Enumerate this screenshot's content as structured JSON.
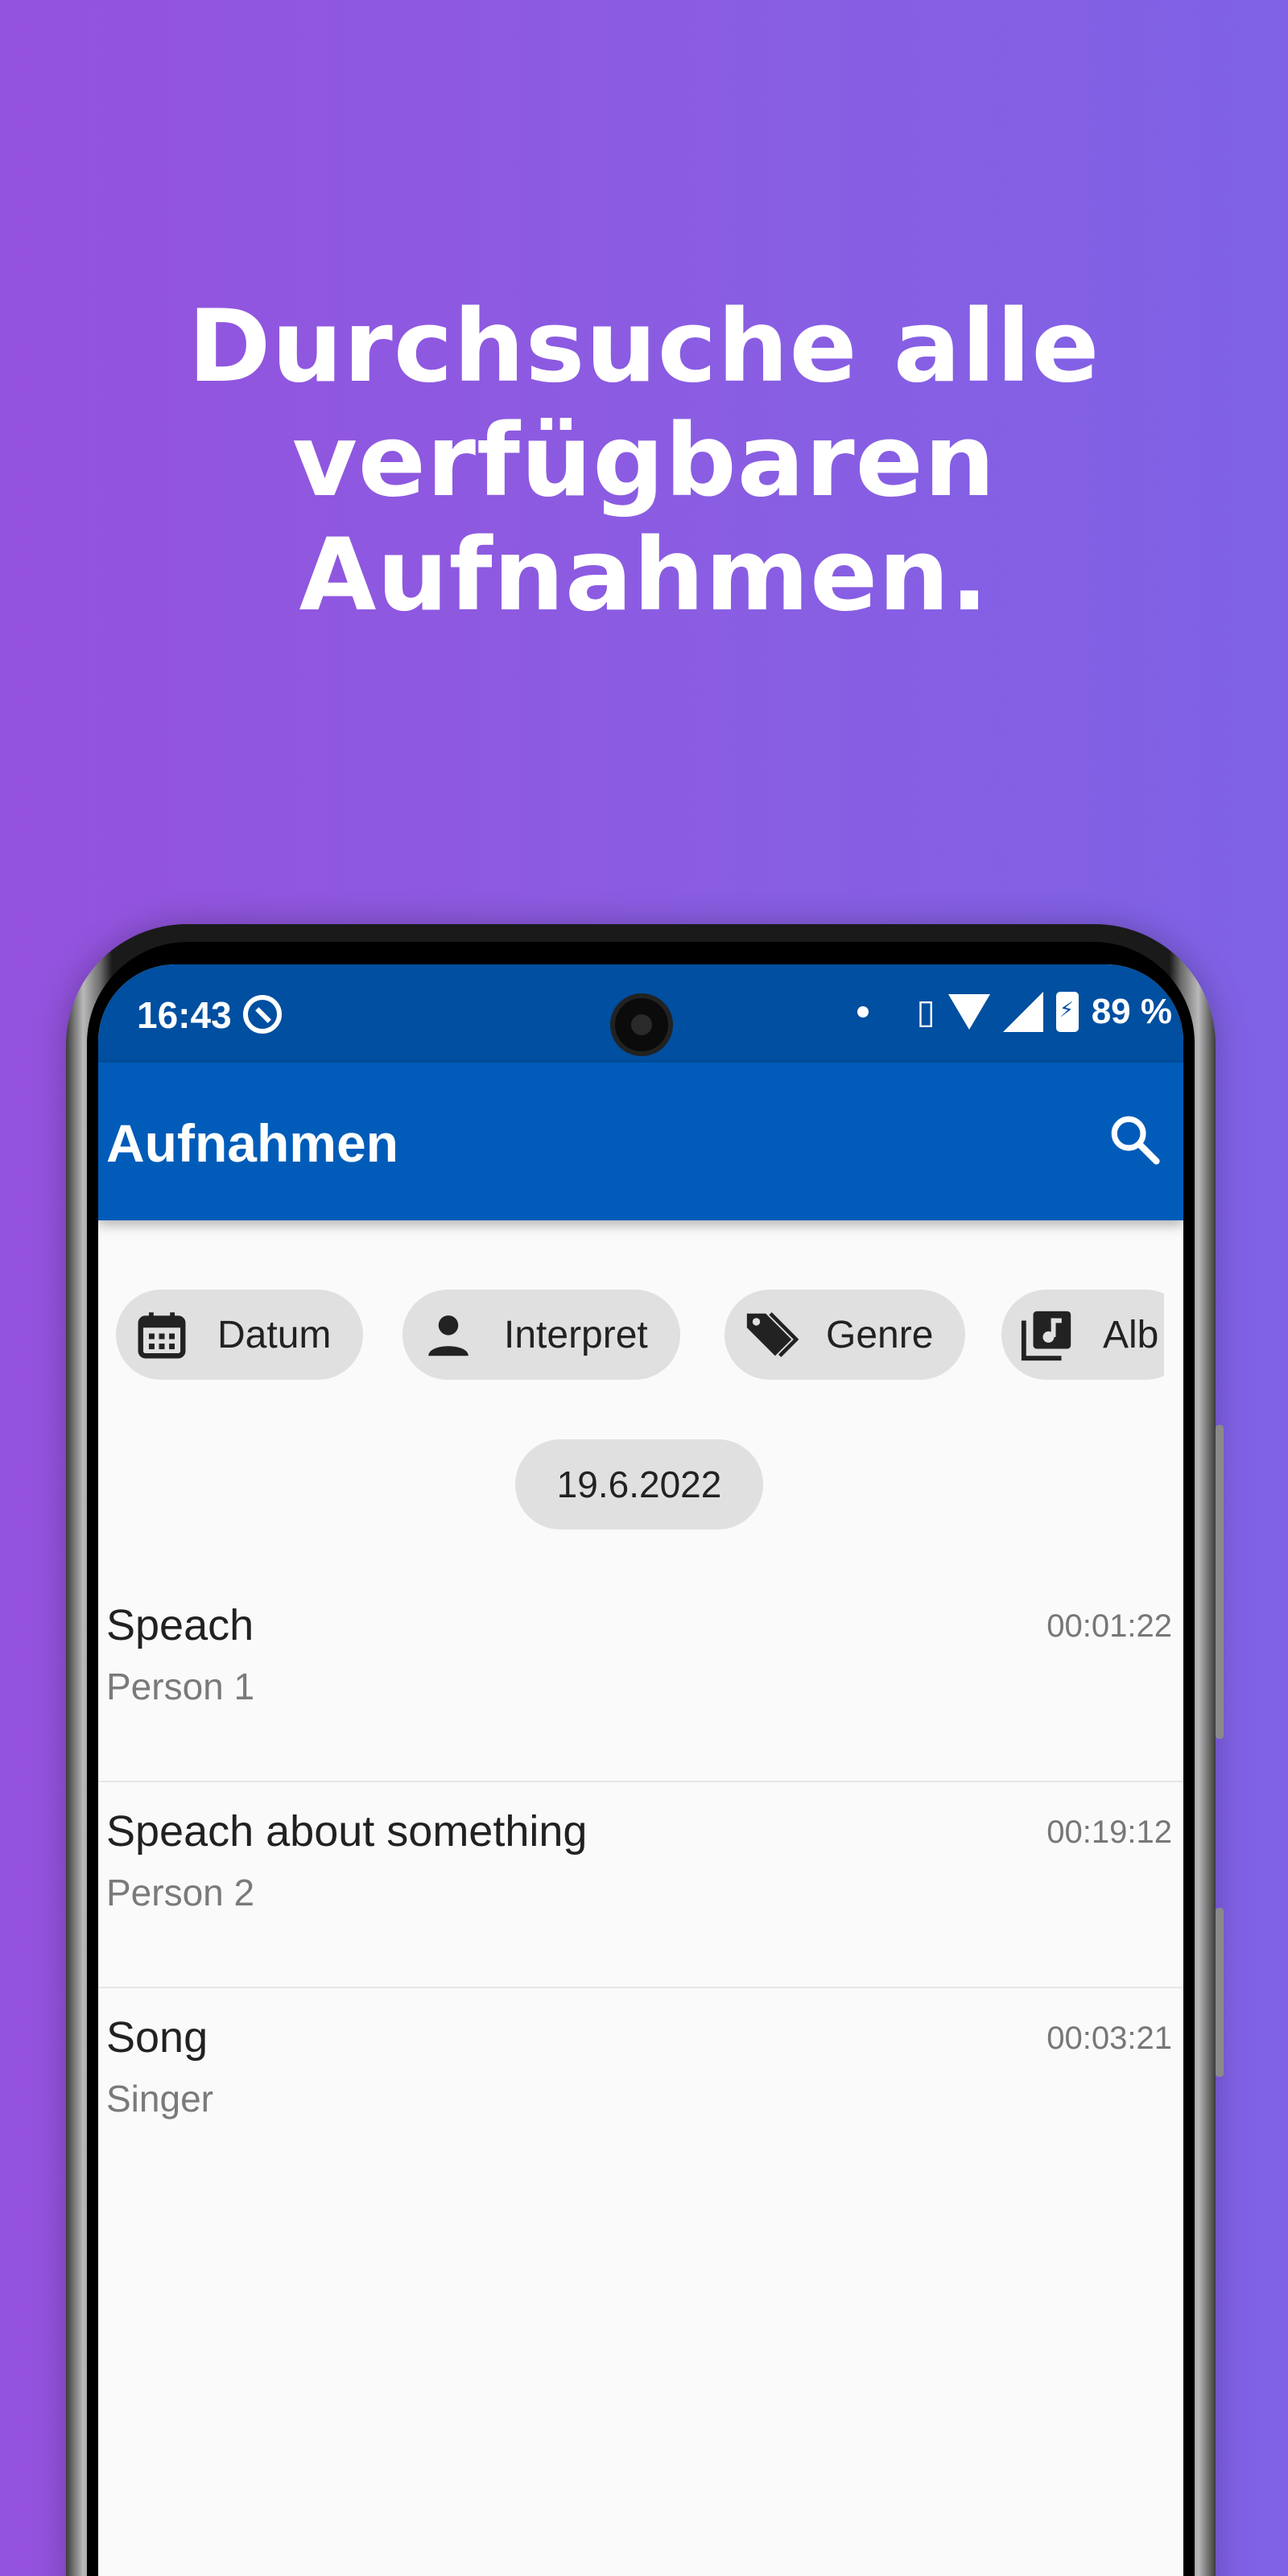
{
  "headline": {
    "line1": "Durchsuche alle",
    "line2": "verfügbaren",
    "line3": "Aufnahmen."
  },
  "statusbar": {
    "time": "16:43",
    "battery": "89 %"
  },
  "appbar": {
    "title": "Aufnahmen",
    "search_icon": "search-icon"
  },
  "filters": [
    {
      "label": "Datum",
      "icon": "calendar-icon"
    },
    {
      "label": "Interpret",
      "icon": "person-icon"
    },
    {
      "label": "Genre",
      "icon": "tag-icon"
    },
    {
      "label": "Alb",
      "icon": "music-library-icon"
    }
  ],
  "date_header": "19.6.2022",
  "recordings": [
    {
      "title": "Speach",
      "artist": "Person 1",
      "duration": "00:01:22"
    },
    {
      "title": "Speach about something",
      "artist": "Person 2",
      "duration": "00:19:12"
    },
    {
      "title": "Song",
      "artist": "Singer",
      "duration": "00:03:21"
    }
  ],
  "colors": {
    "statusbar": "#004fa0",
    "appbar": "#005cb8",
    "chip": "#e0e0e0",
    "gradient_start": "#9452dd",
    "gradient_end": "#7f62e6"
  }
}
